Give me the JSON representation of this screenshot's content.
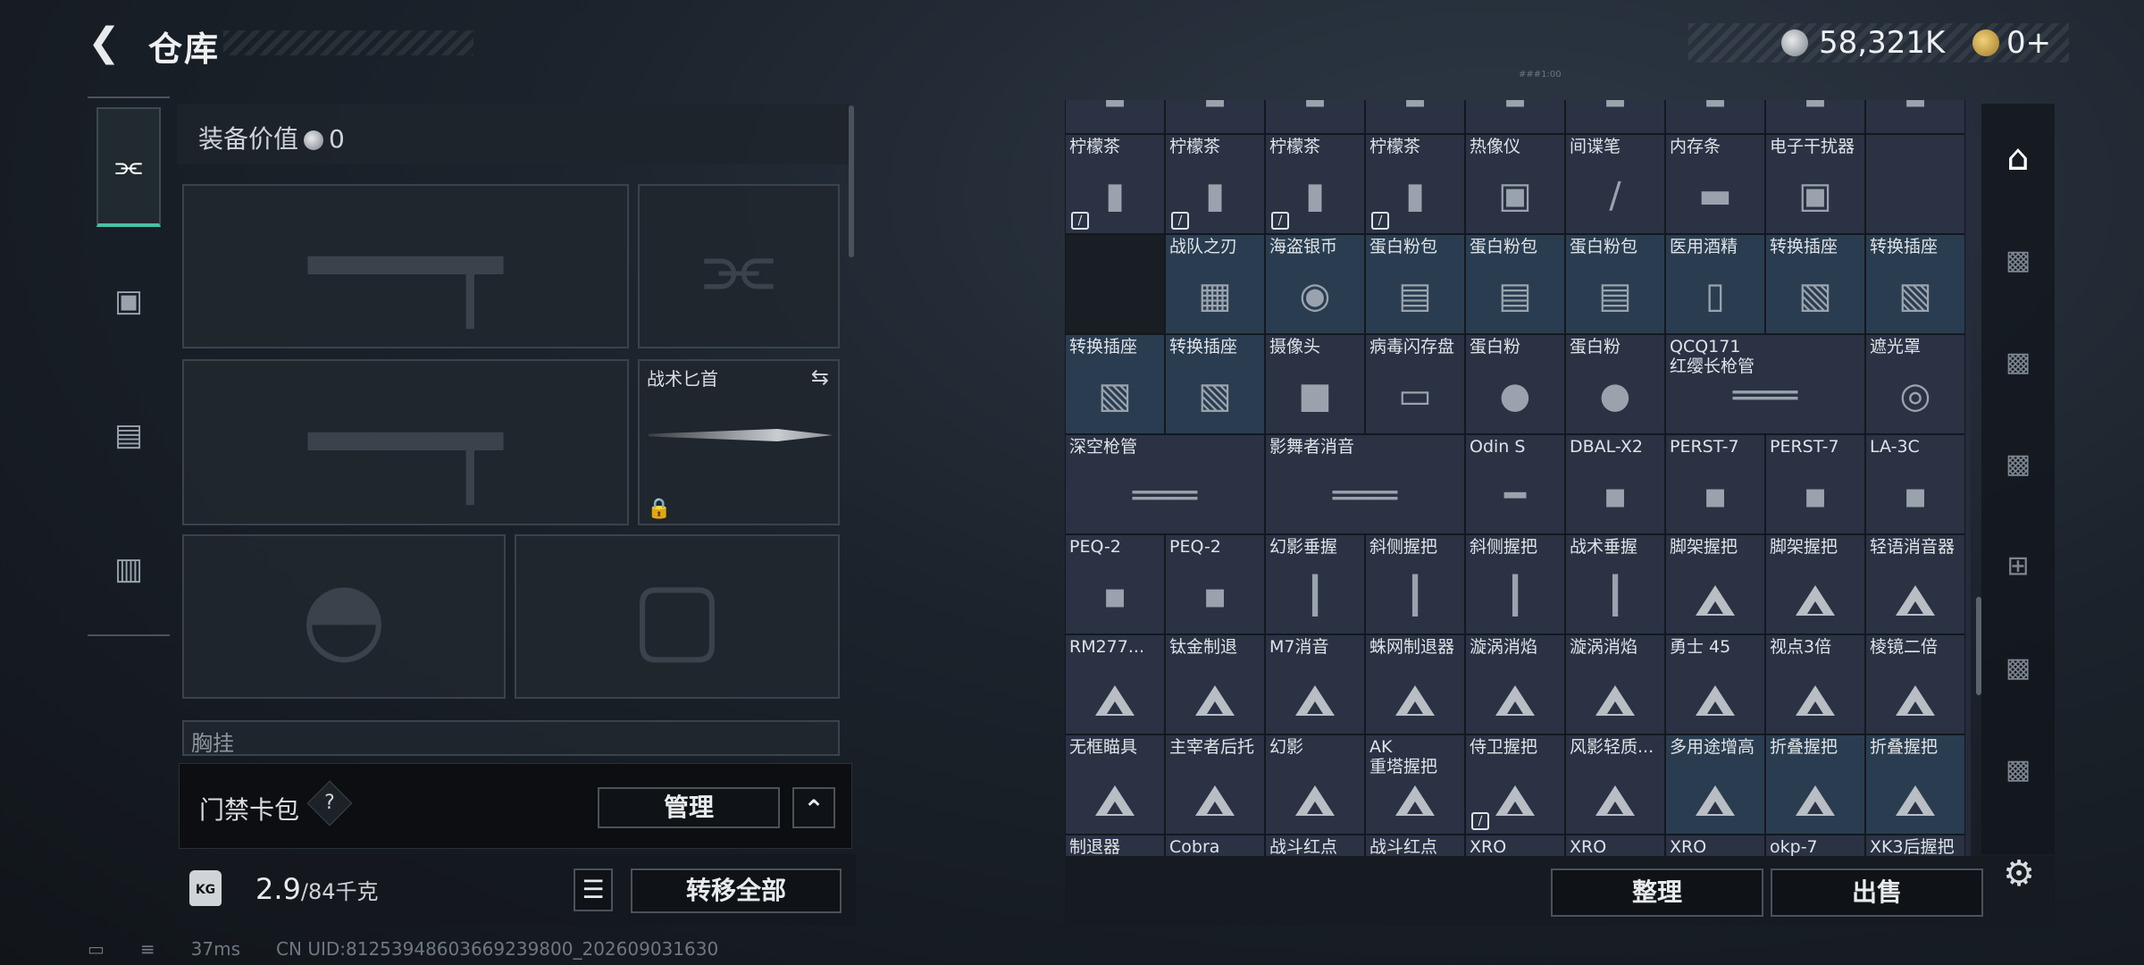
{
  "header": {
    "title": "仓库",
    "silver": "58,321K",
    "gold": "0+",
    "uid_tiny": "###1:00"
  },
  "loadout": {
    "value_label": "装备价值",
    "value": "0",
    "knife_label": "战术匕首",
    "chest_label": "胸挂"
  },
  "keycard": {
    "label": "门禁卡包",
    "help": "?",
    "manage": "管理",
    "expand": "^"
  },
  "footer_left": {
    "weight_icon": "KG",
    "weight_current": "2.9",
    "weight_max": "/84千克",
    "transfer_all": "转移全部"
  },
  "grid_footer": {
    "sort": "整理",
    "sell": "出售"
  },
  "status": {
    "ping": "37ms",
    "uid": "CN UID:81253948603669239800_202609031630"
  },
  "grid": {
    "rows": [
      [
        {
          "n": "",
          "i": "partial"
        },
        {
          "n": "",
          "i": "partial"
        },
        {
          "n": "",
          "i": "partial"
        },
        {
          "n": "",
          "i": "partial"
        },
        {
          "n": "",
          "i": "partial"
        },
        {
          "n": "",
          "i": "partial"
        },
        {
          "n": "",
          "i": "partial"
        },
        {
          "n": "",
          "i": "partial"
        },
        {
          "n": "",
          "i": "partial"
        }
      ],
      [
        {
          "n": "柠檬茶",
          "i": "can",
          "ban": true
        },
        {
          "n": "柠檬茶",
          "i": "can",
          "ban": true
        },
        {
          "n": "柠檬茶",
          "i": "can",
          "ban": true
        },
        {
          "n": "柠檬茶",
          "i": "can",
          "ban": true
        },
        {
          "n": "热像仪",
          "i": "device"
        },
        {
          "n": "间谍笔",
          "i": "pen"
        },
        {
          "n": "内存条",
          "i": "ram"
        },
        {
          "n": "电子干扰器",
          "i": "device"
        },
        {
          "n": "",
          "i": "empty"
        }
      ],
      [
        {
          "n": "",
          "i": "dark"
        },
        {
          "n": "战队之刃",
          "i": "card",
          "b": true
        },
        {
          "n": "海盗银币",
          "i": "coin",
          "b": true
        },
        {
          "n": "蛋白粉包",
          "i": "bag",
          "b": true
        },
        {
          "n": "蛋白粉包",
          "i": "bag",
          "b": true
        },
        {
          "n": "蛋白粉包",
          "i": "bag",
          "b": true
        },
        {
          "n": "医用酒精",
          "i": "bottle",
          "b": true
        },
        {
          "n": "转换插座",
          "i": "plug",
          "b": true
        },
        {
          "n": "转换插座",
          "i": "plug",
          "b": true
        }
      ],
      [
        {
          "n": "转换插座",
          "i": "plug",
          "b": true
        },
        {
          "n": "转换插座",
          "i": "plug",
          "b": true
        },
        {
          "n": "摄像头",
          "i": "camera"
        },
        {
          "n": "病毒闪存盘",
          "i": "usb"
        },
        {
          "n": "蛋白粉",
          "i": "jar"
        },
        {
          "n": "蛋白粉",
          "i": "jar"
        },
        {
          "n": "QCQ171\n红缨长枪管",
          "i": "barrel",
          "w": 2
        },
        {
          "n": "遮光罩",
          "i": "hood"
        }
      ],
      [
        {
          "n": "深空枪管",
          "i": "barrel",
          "w": 2
        },
        {
          "n": "影舞者消音",
          "i": "barrel",
          "w": 2
        },
        {
          "n": "Odin S",
          "i": "scope"
        },
        {
          "n": "DBAL-X2",
          "i": "laser"
        },
        {
          "n": "PERST-7",
          "i": "laser"
        },
        {
          "n": "PERST-7",
          "i": "laser"
        },
        {
          "n": "LA-3C",
          "i": "laser"
        }
      ],
      [
        {
          "n": "PEQ-2",
          "i": "laser"
        },
        {
          "n": "PEQ-2",
          "i": "laser"
        },
        {
          "n": "幻影垂握",
          "i": "grip"
        },
        {
          "n": "斜侧握把",
          "i": "grip"
        },
        {
          "n": "斜侧握把",
          "i": "grip"
        },
        {
          "n": "战术垂握",
          "i": "grip"
        },
        {
          "n": "脚架握把",
          "i": "tri"
        },
        {
          "n": "脚架握把",
          "i": "tri"
        },
        {
          "n": "轻语消音器",
          "i": "tri"
        }
      ],
      [
        {
          "n": "RM277...",
          "i": "tri"
        },
        {
          "n": "钛金制退",
          "i": "tri"
        },
        {
          "n": "M7消音",
          "i": "tri"
        },
        {
          "n": "蛛网制退器",
          "i": "tri"
        },
        {
          "n": "漩涡消焰",
          "i": "tri"
        },
        {
          "n": "漩涡消焰",
          "i": "tri"
        },
        {
          "n": "勇士 45",
          "i": "tri"
        },
        {
          "n": "视点3倍",
          "i": "tri"
        },
        {
          "n": "棱镜二倍",
          "i": "tri"
        }
      ],
      [
        {
          "n": "无框瞄具",
          "i": "tri"
        },
        {
          "n": "主宰者后托",
          "i": "tri"
        },
        {
          "n": "幻影",
          "i": "tri"
        },
        {
          "n": "AK\n重塔握把",
          "i": "tri"
        },
        {
          "n": "侍卫握把",
          "i": "tri",
          "ban": true
        },
        {
          "n": "风影轻质...",
          "i": "tri"
        },
        {
          "n": "多用途增高",
          "i": "tri",
          "b": true
        },
        {
          "n": "折叠握把",
          "i": "tri",
          "b": true
        },
        {
          "n": "折叠握把",
          "i": "tri",
          "b": true
        }
      ],
      [
        {
          "n": "制退器",
          "i": "tri"
        },
        {
          "n": "Cobra",
          "i": "tri"
        },
        {
          "n": "战斗红点",
          "i": "tri"
        },
        {
          "n": "战斗红点",
          "i": "tri"
        },
        {
          "n": "XRO",
          "i": "tri"
        },
        {
          "n": "XRO",
          "i": "tri"
        },
        {
          "n": "XRO",
          "i": "tri"
        },
        {
          "n": "okp-7",
          "i": "tri"
        },
        {
          "n": "XK3后握把",
          "i": "tri"
        }
      ]
    ]
  },
  "icons": {
    "back": "arrow-left-icon",
    "gun": "pistol-icon",
    "backpack": "backpack-icon",
    "vest": "vest-icon",
    "case": "briefcase-icon",
    "gear": "gear-icon"
  }
}
